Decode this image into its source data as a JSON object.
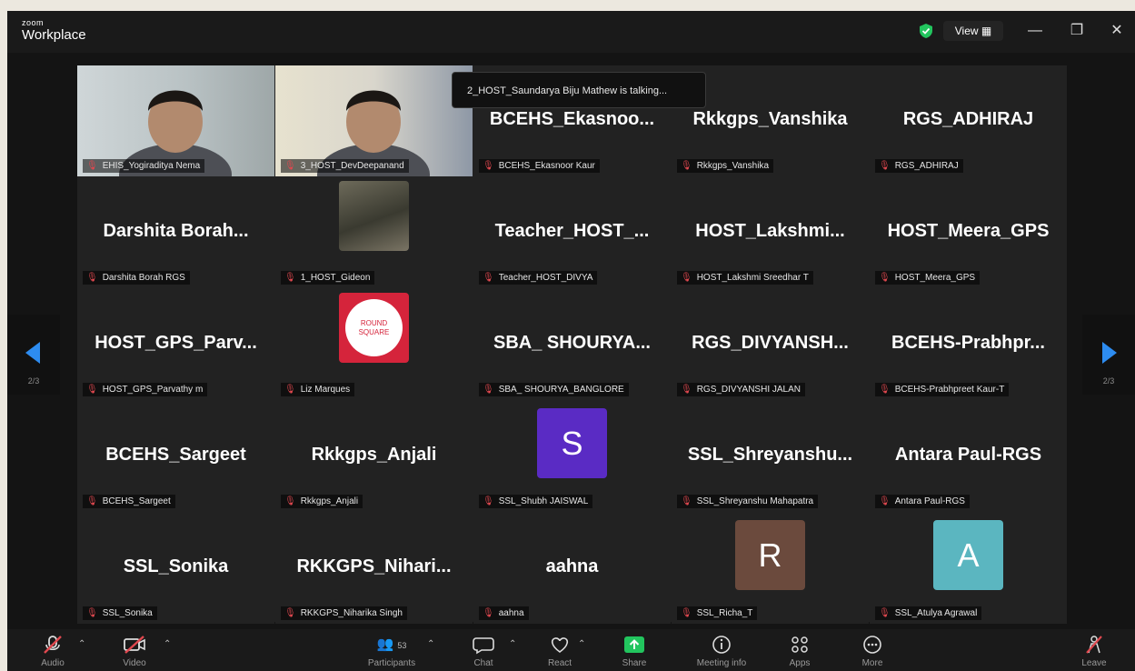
{
  "app": {
    "logo_line1": "zoom",
    "logo_line2": "Workplace",
    "view_label": "View ▦"
  },
  "talking_banner": "2_HOST_Saundarya Biju Mathew is talking...",
  "page_indicator": "2/3",
  "tiles": [
    {
      "title": "",
      "name": "EHIS_Yogiraditya Nema",
      "type": "video-person"
    },
    {
      "title": "",
      "name": "3_HOST_DevDeepanand",
      "type": "video-person-poster"
    },
    {
      "title": "BCEHS_Ekasnoo...",
      "name": "BCEHS_Ekasnoor Kaur",
      "type": "text"
    },
    {
      "title": "Rkkgps_Vanshika",
      "name": "Rkkgps_Vanshika",
      "type": "text"
    },
    {
      "title": "RGS_ADHIRAJ",
      "name": "RGS_ADHIRAJ",
      "type": "text"
    },
    {
      "title": "Darshita Borah...",
      "name": "Darshita Borah RGS",
      "type": "text"
    },
    {
      "title": "",
      "name": "1_HOST_Gideon",
      "type": "photo"
    },
    {
      "title": "Teacher_HOST_...",
      "name": "Teacher_HOST_DIVYA",
      "type": "text"
    },
    {
      "title": "HOST_Lakshmi...",
      "name": "HOST_Lakshmi Sreedhar T",
      "type": "text"
    },
    {
      "title": "HOST_Meera_GPS",
      "name": "HOST_Meera_GPS",
      "type": "text"
    },
    {
      "title": "HOST_GPS_Parv...",
      "name": "HOST_GPS_Parvathy m",
      "type": "text"
    },
    {
      "title": "",
      "name": "Liz Marques",
      "type": "logo",
      "logo_text": "ROUND SQUARE"
    },
    {
      "title": "SBA_ SHOURYA...",
      "name": "SBA_ SHOURYA_BANGLORE",
      "type": "text"
    },
    {
      "title": "RGS_DIVYANSH...",
      "name": "RGS_DIVYANSHI JALAN",
      "type": "text"
    },
    {
      "title": "BCEHS-Prabhpr...",
      "name": "BCEHS-Prabhpreet Kaur-T",
      "type": "text"
    },
    {
      "title": "BCEHS_Sargeet",
      "name": "BCEHS_Sargeet",
      "type": "text"
    },
    {
      "title": "Rkkgps_Anjali",
      "name": "Rkkgps_Anjali",
      "type": "text"
    },
    {
      "title": "",
      "name": "SSL_Shubh JAISWAL",
      "type": "avatar",
      "letter": "S",
      "color": "#5a2bc4"
    },
    {
      "title": "SSL_Shreyanshu...",
      "name": "SSL_Shreyanshu Mahapatra",
      "type": "text"
    },
    {
      "title": "Antara Paul-RGS",
      "name": "Antara Paul-RGS",
      "type": "text"
    },
    {
      "title": "SSL_Sonika",
      "name": "SSL_Sonika",
      "type": "text"
    },
    {
      "title": "RKKGPS_Nihari...",
      "name": "RKKGPS_Niharika Singh",
      "type": "text"
    },
    {
      "title": "aahna",
      "name": "aahna",
      "type": "text"
    },
    {
      "title": "",
      "name": "SSL_Richa_T",
      "type": "avatar",
      "letter": "R",
      "color": "#6b4a3d"
    },
    {
      "title": "",
      "name": "SSL_Atulya Agrawal",
      "type": "avatar",
      "letter": "A",
      "color": "#5bb6c0"
    }
  ],
  "toolbar": {
    "audio": "Audio",
    "video": "Video",
    "participants": "Participants",
    "participant_count": "53",
    "chat": "Chat",
    "react": "React",
    "share": "Share",
    "meeting_info": "Meeting info",
    "apps": "Apps",
    "more": "More",
    "leave": "Leave"
  },
  "colors": {
    "accent_green": "#22c55e",
    "nav_arrow": "#2d8cf0",
    "muted_red": "#e0484f"
  }
}
